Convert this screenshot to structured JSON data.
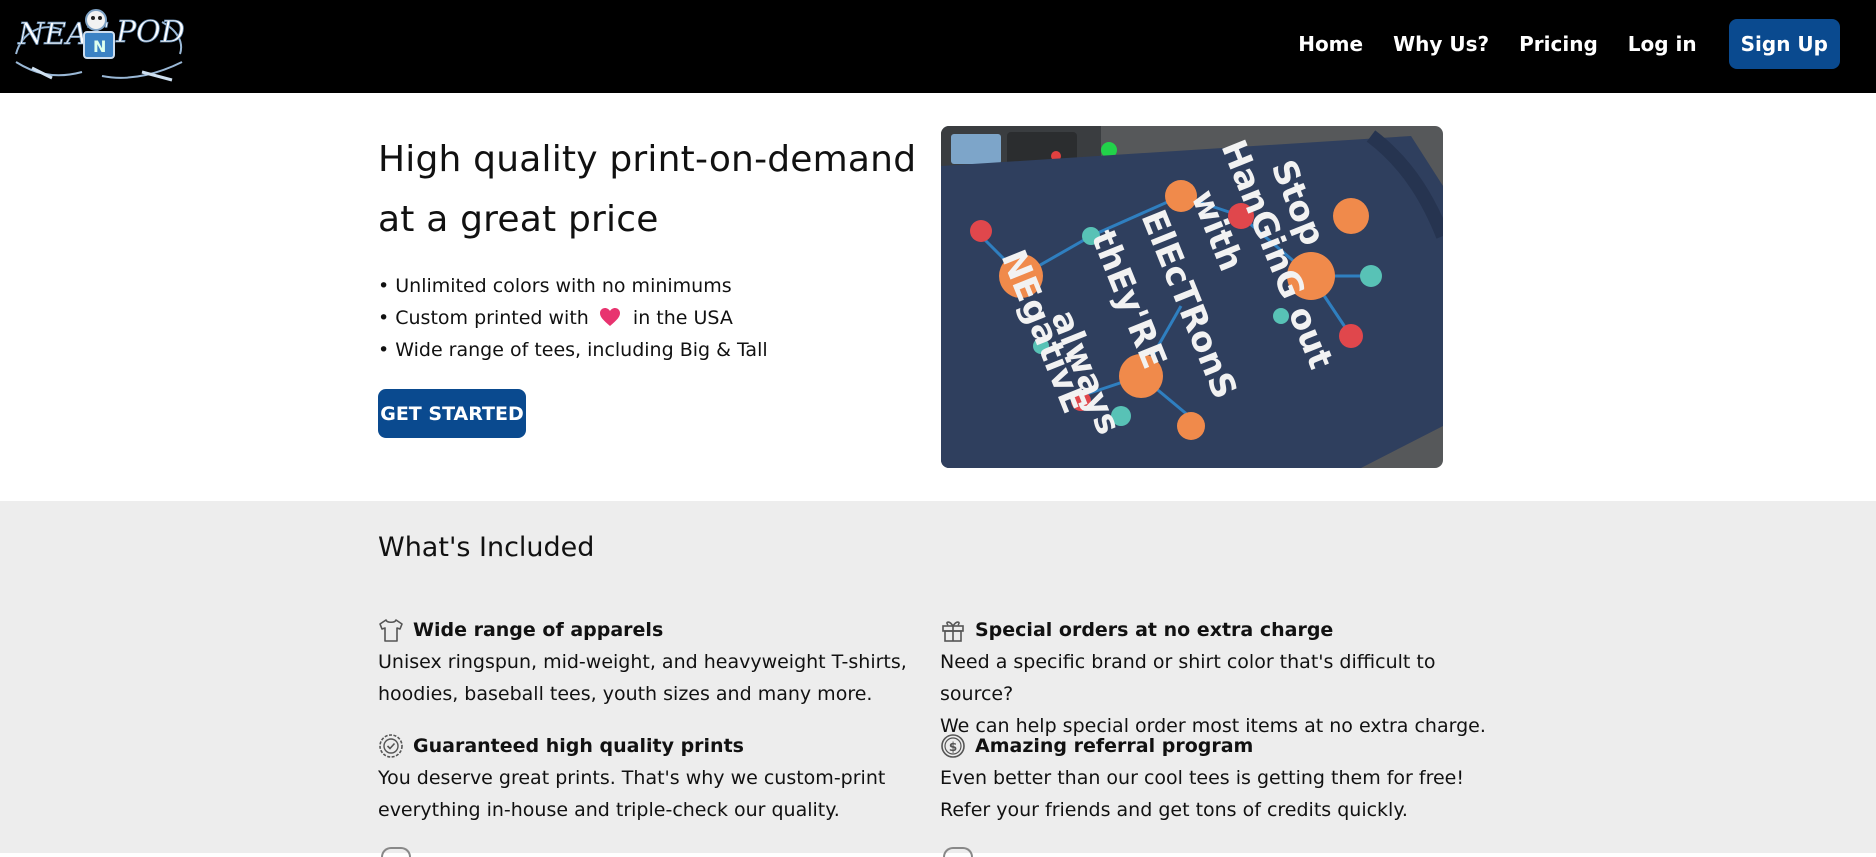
{
  "brand": {
    "logo_icon": "neato-pod-logo"
  },
  "nav": {
    "items": [
      {
        "label": "Home"
      },
      {
        "label": "Why Us?"
      },
      {
        "label": "Pricing"
      },
      {
        "label": "Log in"
      }
    ],
    "signup_label": "Sign Up"
  },
  "hero": {
    "title": "High quality print-on-demand at a great price",
    "bullets": {
      "b1": "• Unlimited colors with no minimums",
      "b2_pre": "• Custom printed with",
      "b2_post": "in the USA",
      "b3": "• Wide range of tees, including Big & Tall"
    },
    "cta_label": "GET STARTED",
    "image": {
      "icon": "printed-tshirt-photo",
      "shirt_text": [
        "Stop",
        "HanGinG out",
        "with",
        "ElEcTRonS",
        "thEy'RE",
        "always",
        "NEgativE"
      ]
    }
  },
  "included": {
    "title": "What's Included",
    "features": [
      {
        "icon": "tshirt-icon",
        "title": "Wide range of apparels",
        "line1": "Unisex ringspun, mid-weight, and heavyweight T-shirts,",
        "line2": "hoodies, baseball tees, youth sizes and many more."
      },
      {
        "icon": "gift-icon",
        "title": "Special orders at no extra charge",
        "line1": "Need a specific brand or shirt color that's difficult to source?",
        "line2": "We can help special order most items at no extra charge."
      },
      {
        "icon": "badge-check-icon",
        "title": "Guaranteed high quality prints",
        "line1": "You deserve great prints. That's why we custom-print",
        "line2": "everything in-house and triple-check our quality."
      },
      {
        "icon": "coin-icon",
        "title": "Amazing referral program",
        "line1": "Even better than our cool tees is getting them for free!",
        "line2": "Refer your friends and get tons of credits quickly."
      }
    ]
  },
  "colors": {
    "nav_bg": "#000000",
    "accent": "#0a4a8f",
    "section_bg": "#ededed",
    "heart": "#e8336f",
    "shirt": "#2f3f5e"
  }
}
